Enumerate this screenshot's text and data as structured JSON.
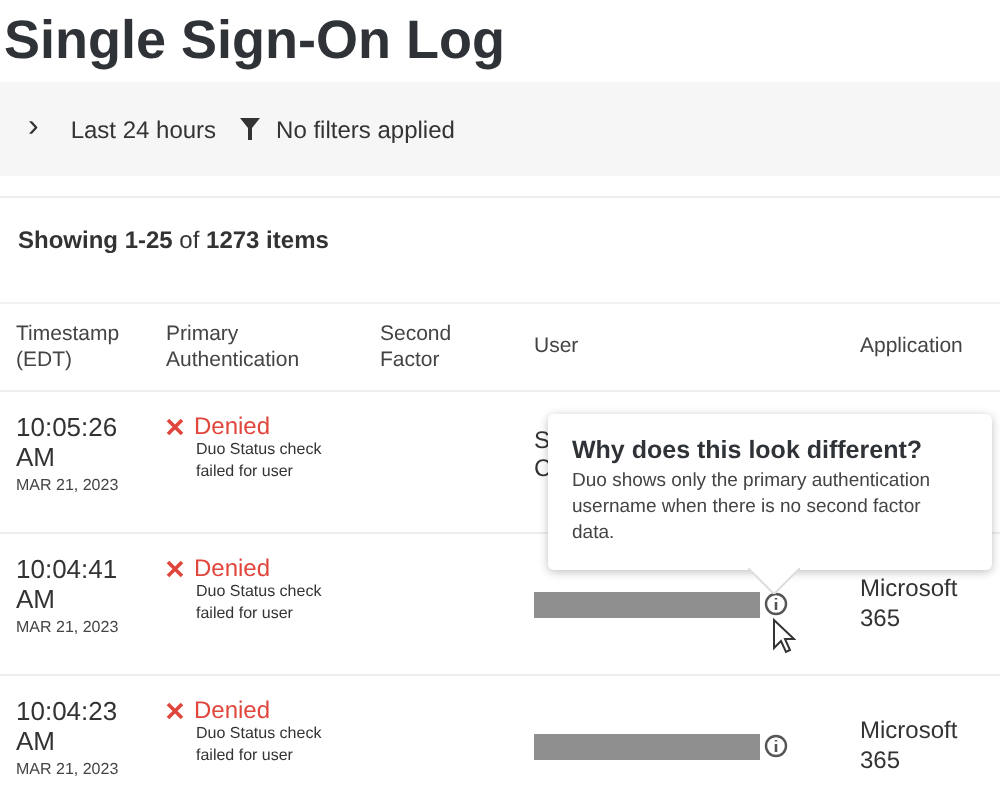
{
  "page": {
    "title": "Single Sign-On Log"
  },
  "filter_bar": {
    "expand_icon": "›",
    "time_range": "Last 24 hours",
    "filters": "No filters applied"
  },
  "summary": {
    "text": "**Showing 1-25** of **1273 items**"
  },
  "table": {
    "columns": [
      "Timestamp (EDT)",
      "Primary Authentication",
      "Second Factor",
      "User",
      "Application"
    ],
    "rows": [
      {
        "time": "10:05:26 AM",
        "date": "MAR 21, 2023",
        "result": "Denied",
        "reason": "Duo Status check failed for user",
        "user": {
          "kind": "text",
          "lines": [
            "S",
            "C"
          ]
        },
        "info": false
      },
      {
        "time": "10:04:41 AM",
        "date": "MAR 21, 2023",
        "result": "Denied",
        "reason": "Duo Status check failed for user",
        "user": {
          "kind": "redacted"
        },
        "info": true,
        "application": "Microsoft 365"
      },
      {
        "time": "10:04:23 AM",
        "date": "MAR 21, 2023",
        "result": "Denied",
        "reason": "Duo Status check failed for user",
        "user": {
          "kind": "redacted"
        },
        "info": true,
        "application": "Microsoft 365"
      }
    ]
  },
  "tooltip": {
    "title": "Why does this look different?",
    "body": "Duo shows only the primary authentication username when there is no second factor data."
  }
}
